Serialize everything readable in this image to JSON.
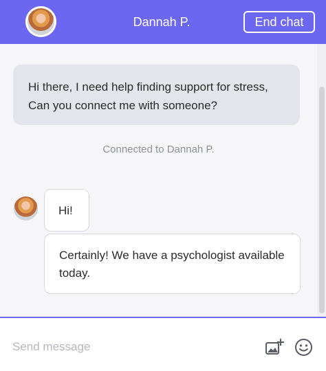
{
  "header": {
    "title": "Dannah P.",
    "end_chat_label": "End chat",
    "avatar_icon": "agent-avatar"
  },
  "conversation": {
    "user_message": "Hi there, I need help finding support for stress, Can you connect me with someone?",
    "system_message": "Connected to Dannah P.",
    "agent_messages": [
      "Hi!",
      "Certainly! We have a psychologist available today."
    ]
  },
  "composer": {
    "placeholder": "Send message",
    "icons": [
      "add-image-icon",
      "emoji-icon"
    ]
  },
  "colors": {
    "accent": "#6c67f0",
    "user_bubble": "#e3e5ea",
    "chat_background": "#f6f6f8"
  }
}
